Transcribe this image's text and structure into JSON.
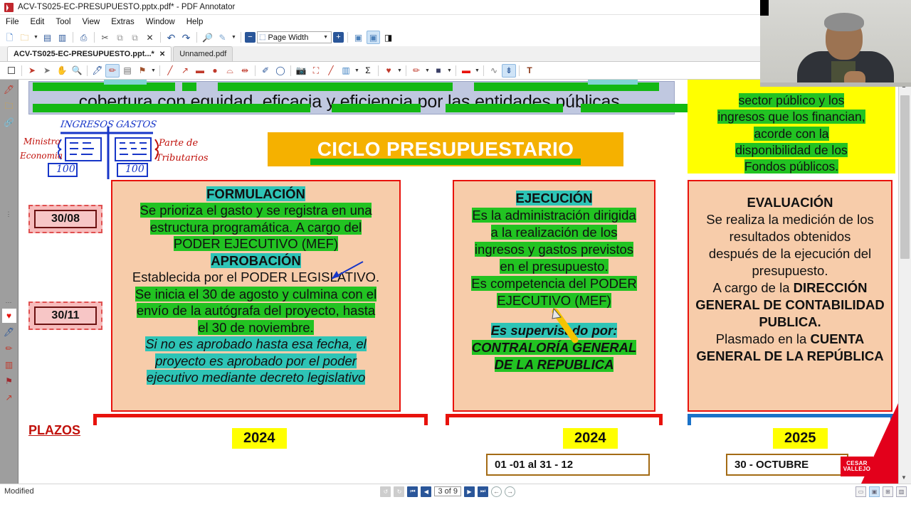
{
  "window": {
    "title": "ACV-TS025-EC-PRESUPUESTO.pptx.pdf* - PDF Annotator",
    "logo_icon": "pdf-annotator-logo-icon"
  },
  "menu": {
    "items": [
      {
        "label": "File"
      },
      {
        "label": "Edit"
      },
      {
        "label": "Tool"
      },
      {
        "label": "View"
      },
      {
        "label": "Extras"
      },
      {
        "label": "Window"
      },
      {
        "label": "Help"
      }
    ]
  },
  "toolbar_main": {
    "zoom_value": "Page Width",
    "buttons": [
      {
        "name": "new-document-icon",
        "glyph": "❐"
      },
      {
        "name": "open-folder-icon",
        "glyph": "📁"
      },
      {
        "name": "open-dropdown-icon",
        "glyph": "▾"
      },
      {
        "name": "save-icon",
        "glyph": "💾"
      },
      {
        "name": "save-as-pdf-icon",
        "glyph": "⎘"
      },
      {
        "name": "print-icon",
        "glyph": "⎙"
      },
      {
        "name": "cut-icon",
        "glyph": "✂"
      },
      {
        "name": "copy-icon",
        "glyph": "❐"
      },
      {
        "name": "paste-icon",
        "glyph": "❑"
      },
      {
        "name": "delete-icon",
        "glyph": "✕"
      },
      {
        "name": "undo-icon",
        "glyph": "↶"
      },
      {
        "name": "redo-icon",
        "glyph": "↷"
      },
      {
        "name": "find-icon",
        "glyph": "🔎"
      },
      {
        "name": "edit-page-icon",
        "glyph": "✎"
      },
      {
        "name": "edit-page-dropdown-icon",
        "glyph": "▾"
      },
      {
        "name": "zoom-out-icon",
        "glyph": "−"
      }
    ],
    "right_buttons": [
      {
        "name": "fit-page-icon",
        "glyph": "⬚"
      },
      {
        "name": "fit-width-icon",
        "glyph": "⬚"
      },
      {
        "name": "single-page-icon",
        "glyph": "■"
      }
    ]
  },
  "tabs": [
    {
      "label": "ACV-TS025-EC-PRESUPUESTO.ppt...*",
      "close_icon": "close-icon",
      "active": true
    },
    {
      "label": "Unnamed.pdf",
      "active": false
    }
  ],
  "toolbar_annotate": {
    "buttons": [
      {
        "name": "page-select-icon",
        "glyph": "□"
      },
      {
        "name": "pointer-icon",
        "glyph": "➤"
      },
      {
        "name": "select-object-icon",
        "glyph": "➤"
      },
      {
        "name": "hand-pan-icon",
        "glyph": "✋"
      },
      {
        "name": "magnifier-icon",
        "glyph": "🔍"
      },
      {
        "name": "pen-freehand-icon",
        "glyph": "✒"
      },
      {
        "name": "pencil-icon",
        "glyph": "✏"
      },
      {
        "name": "highlighter-icon",
        "glyph": "▬"
      },
      {
        "name": "stamp-icon",
        "glyph": "⚑"
      },
      {
        "name": "stamp-dropdown-icon",
        "glyph": "▾"
      },
      {
        "name": "line-icon",
        "glyph": "╱"
      },
      {
        "name": "arrow-icon",
        "glyph": "↗"
      },
      {
        "name": "rectangle-icon",
        "glyph": "▬"
      },
      {
        "name": "ellipse-icon",
        "glyph": "●"
      },
      {
        "name": "polygon-icon",
        "glyph": "⌔"
      },
      {
        "name": "dimension-icon",
        "glyph": "⇔"
      },
      {
        "name": "eraser-icon",
        "glyph": "✐"
      },
      {
        "name": "lasso-eraser-icon",
        "glyph": "◯"
      },
      {
        "name": "snapshot-camera-icon",
        "glyph": "📷"
      },
      {
        "name": "crop-icon",
        "glyph": "✂"
      },
      {
        "name": "ruler-icon",
        "glyph": "╱"
      },
      {
        "name": "insert-image-icon",
        "glyph": "❐"
      },
      {
        "name": "insert-image-dropdown-icon",
        "glyph": "▾"
      },
      {
        "name": "formula-icon",
        "glyph": "Σ"
      },
      {
        "name": "favorite-heart-icon",
        "glyph": "♥"
      },
      {
        "name": "favorite-dropdown-icon",
        "glyph": "▾"
      },
      {
        "name": "pen-color-icon",
        "glyph": "✏"
      },
      {
        "name": "pen-color-dropdown-icon",
        "glyph": "▾"
      },
      {
        "name": "fill-color-icon",
        "glyph": "■"
      },
      {
        "name": "fill-color-dropdown-icon",
        "glyph": "▾"
      },
      {
        "name": "line-color-icon",
        "glyph": "▬"
      },
      {
        "name": "line-color-dropdown-icon",
        "glyph": "▾"
      },
      {
        "name": "curve-icon",
        "glyph": "∿"
      },
      {
        "name": "text-insert-icon",
        "glyph": "↓"
      },
      {
        "name": "text-box-icon",
        "glyph": "T"
      }
    ]
  },
  "rail": {
    "items": [
      {
        "name": "rail-pen-icon",
        "glyph": "✒"
      },
      {
        "name": "rail-folder-icon",
        "glyph": "📁"
      },
      {
        "name": "rail-attachment-icon",
        "glyph": "🔗"
      },
      {
        "name": "rail-favorite-icon",
        "glyph": "♥"
      },
      {
        "name": "rail-pen2-icon",
        "glyph": "✒"
      },
      {
        "name": "rail-pencil-icon",
        "glyph": "✏"
      },
      {
        "name": "rail-image-icon",
        "glyph": "❐"
      },
      {
        "name": "rail-stamp-icon",
        "glyph": "⚑"
      },
      {
        "name": "rail-arrow-icon",
        "glyph": "↗"
      }
    ]
  },
  "slide": {
    "header_banner": {
      "line1_partial": "",
      "line2": "cobertura con equidad, eficacia y eficiencia por las entidades públicas."
    },
    "yellow_note": {
      "lines": [
        "sector público y los",
        "ingresos que los financian,",
        "acorde con la",
        "disponibilidad de los",
        "Fondos públicos."
      ]
    },
    "title": "CICLO PRESUPUESTARIO",
    "handwriting": {
      "ingresos": "INGRESOS",
      "gastos": "GASTOS",
      "ministro": "Ministro",
      "economia": "Economia",
      "parte_de": "Parte de",
      "tributarios": "Tributarios",
      "amount_left": "100",
      "amount_right": "100"
    },
    "date_chips": [
      {
        "label": "30/08"
      },
      {
        "label": "30/11"
      }
    ],
    "cards": [
      {
        "name": "formulacion-aprobacion-card",
        "headings": [
          "FORMULACIÓN",
          "APROBACIÓN"
        ],
        "body_formulacion": [
          "Se prioriza el gasto y se registra en una",
          "estructura  programática. A cargo del",
          "PODER EJECUTIVO (MEF)"
        ],
        "body_aprobacion": [
          "Establecida por el PODER LEGISLATIVO.",
          "Se inicia el 30 de agosto y  culmina con el",
          "envío de la autógrafa del proyecto, hasta",
          "el 30 de noviembre."
        ],
        "body_italic": [
          "Si no es aprobado hasta esa fecha, el",
          "proyecto es aprobado por el poder",
          "ejecutivo mediante decreto legislativo"
        ]
      },
      {
        "name": "ejecucion-card",
        "heading": "EJECUCIÓN",
        "body": [
          "Es la administración dirigida",
          "a la realización de los",
          "ingresos y gastos previstos",
          "en el presupuesto.",
          "Es competencia  del PODER",
          "EJECUTIVO (MEF)"
        ],
        "supervised_label": "Es supervisado por:",
        "supervised_body": [
          "CONTRALORÍA  GENERAL",
          "DE LA REPUBLICA"
        ]
      },
      {
        "name": "evaluacion-card",
        "heading": "EVALUACIÓN",
        "body": [
          "Se realiza la medición de los",
          "resultados obtenidos",
          "después de la ejecución del",
          "presupuesto."
        ],
        "line_a_prefix": "A cargo de la ",
        "line_a_bold": "DIRECCIÓN GENERAL DE CONTABILIDAD PUBLICA.",
        "line_b_prefix": "Plasmado en la ",
        "line_b_bold": "CUENTA GENERAL DE LA REPÚBLICA"
      }
    ],
    "plazos_label": "PLAZOS",
    "years": [
      "2024",
      "2024",
      "2025"
    ],
    "ranges": [
      {
        "label": "01 -01 al 31 - 12"
      },
      {
        "label": "30 - OCTUBRE"
      }
    ],
    "logo": {
      "line1": "CESAR",
      "line2": "VALLEJO"
    }
  },
  "statusbar": {
    "status": "Modified",
    "page_indicator": "3 of 9",
    "nav": [
      {
        "name": "rotate-left-icon",
        "glyph": "↺"
      },
      {
        "name": "rotate-right-icon",
        "glyph": "↻"
      },
      {
        "name": "first-page-icon",
        "glyph": "⏮"
      },
      {
        "name": "prev-page-icon",
        "glyph": "◀"
      },
      {
        "name": "next-page-icon",
        "glyph": "▶"
      },
      {
        "name": "last-page-icon",
        "glyph": "⏭"
      },
      {
        "name": "back-icon",
        "glyph": "⇦"
      },
      {
        "name": "forward-icon",
        "glyph": "⇨"
      }
    ],
    "view_modes": [
      {
        "name": "view-single-icon",
        "glyph": "▭"
      },
      {
        "name": "view-fit-icon",
        "glyph": "▣"
      },
      {
        "name": "view-continuous-icon",
        "glyph": "⊞"
      },
      {
        "name": "view-facing-icon",
        "glyph": "▥"
      }
    ]
  },
  "colors": {
    "accent_orange": "#f5b100",
    "card_fill": "#f7ccaa",
    "card_border": "#e8120c",
    "highlight_green": "#22c322",
    "highlight_teal": "#2ec4b6",
    "highlight_yellow": "#ffff00",
    "banner_blue": "#c0c8e0",
    "brand_red": "#e3001b"
  }
}
